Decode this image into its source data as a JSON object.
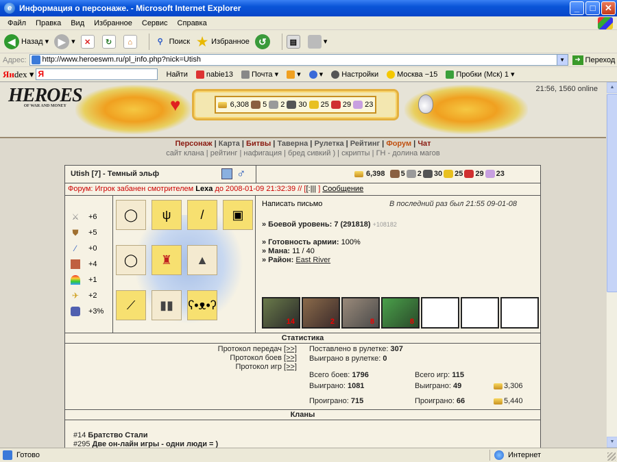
{
  "window": {
    "title": "Информация о персонаже. - Microsoft Internet Explorer"
  },
  "menu": [
    "Файл",
    "Правка",
    "Вид",
    "Избранное",
    "Сервис",
    "Справка"
  ],
  "toolbar": {
    "back": "Назад",
    "search": "Поиск",
    "favorites": "Избранное"
  },
  "address": {
    "label": "Адрес:",
    "url": "http://www.heroeswm.ru/pl_info.php?nick=Utish",
    "go": "Переход"
  },
  "yandex": {
    "logo_a": "Ян",
    "logo_b": "dex",
    "search_btn": "Найти",
    "items": [
      "nabie13",
      "Почта",
      "Настройки",
      "Москва −15",
      "Пробки (Мск) 1"
    ]
  },
  "game": {
    "logo": "HEROES",
    "logo_sub": "OF WAR AND MONEY",
    "clock": "21:56, 1560 online",
    "top_res": [
      "6,308",
      "5",
      "2",
      "30",
      "25",
      "29",
      "23"
    ],
    "nav": [
      "Персонаж",
      "Карта",
      "Битвы",
      "Таверна",
      "Рулетка",
      "Рейтинг",
      "Форум",
      "Чат"
    ],
    "nav2": [
      "сайт клана",
      "рейтинг",
      "нафигация",
      "бред сивкий )",
      "скрипты",
      "ГН - долина магов"
    ]
  },
  "character": {
    "name": "Utish  [7] - Темный эльф",
    "resources": [
      "6,398",
      "5",
      "2",
      "30",
      "25",
      "29",
      "23"
    ],
    "forum_prefix": "Форум:",
    "forum_text": "Игрок забанен смотрителем",
    "forum_nick": "Lexa",
    "forum_date": "до 2008-01-09 21:32:39 // [",
    "forum_links": "[:|||",
    "forum_close": "]",
    "forum_msg": "Сообщение",
    "stats": [
      "+6",
      "+5",
      "+0",
      "+4",
      "+1",
      "+2",
      "+3%"
    ],
    "write_letter": "Написать письмо",
    "last_seen": "В последний раз был 21:55 09-01-08",
    "combat_label": "» Боевой уровень:",
    "combat_value": "7 (291818)",
    "combat_extra": "+108182",
    "army_label": "» Готовность армии:",
    "army_value": "100%",
    "mana_label": "» Мана:",
    "mana_value": "11 / 40",
    "region_label": "» Район:",
    "region_value": "East River",
    "army_counts": [
      "14",
      "2",
      "8",
      "8"
    ]
  },
  "statistics": {
    "title": "Статистика",
    "left": [
      {
        "label": "Протокол передач",
        "link": "[>>]"
      },
      {
        "label": "Протокол боев",
        "link": "[>>]"
      },
      {
        "label": "Протокол игр",
        "link": "[>>]"
      }
    ],
    "roulette_bet_label": "Поставлено в рулетке:",
    "roulette_bet": "307",
    "roulette_won_label": "Выиграно в рулетке:",
    "roulette_won": "0",
    "battles_label": "Всего боев:",
    "battles": "1796",
    "won_label": "Выиграно:",
    "won": "1081",
    "lost_label": "Проиграно:",
    "lost": "715",
    "games_label": "Всего игр:",
    "games": "115",
    "games_won": "49",
    "games_lost": "66",
    "gold_won": "3,306",
    "gold_lost": "5,440"
  },
  "clans": {
    "title": "Кланы",
    "items": [
      {
        "id": "#14",
        "name": "Братство Стали"
      },
      {
        "id": "#295",
        "name": "Две он-лайн игры - одни люди = )"
      }
    ]
  },
  "status": {
    "left": "Готово",
    "zone": "Интернет"
  }
}
